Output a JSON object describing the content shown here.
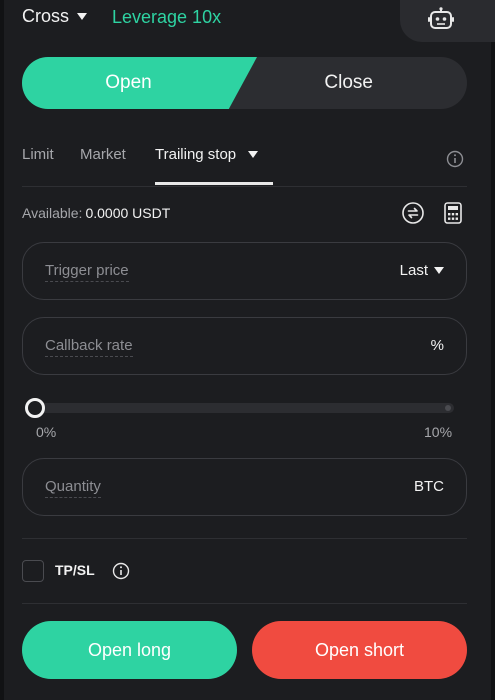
{
  "header": {
    "margin_mode": "Cross",
    "leverage": "Leverage 10x",
    "robot_icon": "robot-icon"
  },
  "side_toggle": {
    "open_label": "Open",
    "close_label": "Close",
    "selected": "Open"
  },
  "order_tabs": {
    "items": [
      "Limit",
      "Market",
      "Trailing stop"
    ],
    "active": "Trailing stop",
    "info_icon": "info-icon"
  },
  "available": {
    "label": "Available:",
    "value": "0.0000 USDT"
  },
  "trigger_price": {
    "placeholder": "Trigger price",
    "type_label": "Last"
  },
  "callback_rate": {
    "placeholder": "Callback rate",
    "unit": "%"
  },
  "slider": {
    "min_label": "0%",
    "max_label": "10%",
    "value": 0
  },
  "quantity": {
    "placeholder": "Quantity",
    "unit": "BTC"
  },
  "tpsl": {
    "label": "TP/SL",
    "checked": false
  },
  "actions": {
    "open_long": "Open long",
    "open_short": "Open short"
  },
  "colors": {
    "accent_green": "#2ed3a2",
    "accent_red": "#f04b40",
    "panel_bg": "#1c1d20"
  }
}
